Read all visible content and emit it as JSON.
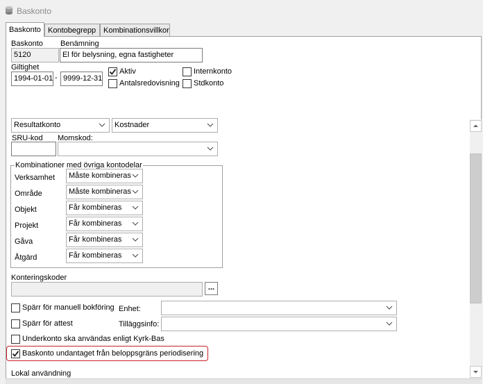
{
  "window": {
    "title": "Baskonto"
  },
  "tabs": [
    {
      "label": "Baskonto"
    },
    {
      "label": "Kontobegrepp"
    },
    {
      "label": "Kombinationsvillkor"
    }
  ],
  "form": {
    "baskonto_label": "Baskonto",
    "baskonto_value": "5120",
    "benamning_label": "Benämning",
    "benamning_value": "El för belysning, egna fastigheter",
    "giltighet_label": "Giltighet",
    "giltighet_from": "1994-01-01",
    "giltighet_sep": "-",
    "giltighet_to": "9999-12-31",
    "aktiv_label": "Aktiv",
    "aktiv_checked": true,
    "antal_label": "Antalsredovisning",
    "antal_checked": false,
    "intern_label": "Internkonto",
    "intern_checked": false,
    "std_label": "Stdkonto",
    "std_checked": false,
    "kontotyp_value": "Resultatkonto",
    "kontoklass_value": "Kostnader",
    "sru_label": "SRU-kod",
    "sru_value": "",
    "moms_label": "Momskod:",
    "moms_value": ""
  },
  "kombinationer": {
    "title": "Kombinationer med övriga kontodelar",
    "rows": [
      {
        "label": "Verksamhet",
        "value": "Måste kombineras"
      },
      {
        "label": "Område",
        "value": "Måste kombineras"
      },
      {
        "label": "Objekt",
        "value": "Får kombineras"
      },
      {
        "label": "Projekt",
        "value": "Får kombineras"
      },
      {
        "label": "Gåva",
        "value": "Får kombineras"
      },
      {
        "label": "Åtgärd",
        "value": "Får kombineras"
      }
    ]
  },
  "kontering": {
    "label": "Konteringskoder",
    "value": "",
    "button_label": "..."
  },
  "options": {
    "sparr_bokforing_label": "Spärr för manuell bokföring",
    "sparr_bokforing_checked": false,
    "enhet_label": "Enhet:",
    "enhet_value": "",
    "sparr_attest_label": "Spärr för attest",
    "sparr_attest_checked": false,
    "tillagg_label": "Tilläggsinfo:",
    "tillagg_value": "",
    "underkonto_label": "Underkonto ska användas enligt Kyrk-Bas",
    "underkonto_checked": false,
    "undantaget_label": "Baskonto undantaget från beloppsgräns periodisering",
    "undantaget_checked": true,
    "lokal_label": "Lokal användning"
  },
  "colors": {
    "highlight": "#c9202a",
    "check": "#1a1a1a"
  }
}
